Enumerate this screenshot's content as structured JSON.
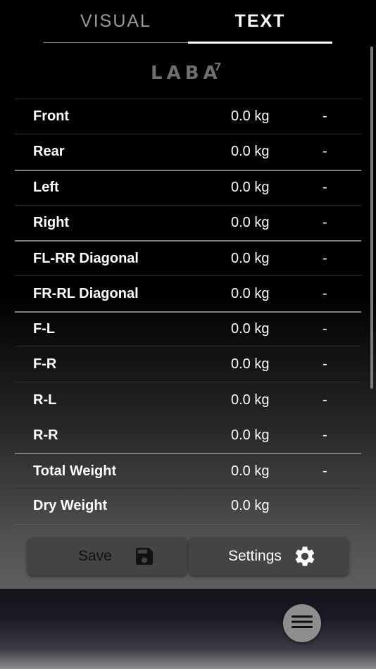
{
  "tabs": [
    {
      "label": "VISUAL",
      "active": false
    },
    {
      "label": "TEXT",
      "active": true
    }
  ],
  "logo": {
    "text": "LABA",
    "superscript": "7"
  },
  "rows": [
    {
      "label": "Front",
      "value": "0.0 kg",
      "extra": "-"
    },
    {
      "label": "Rear",
      "value": "0.0 kg",
      "extra": "-"
    },
    {
      "label": "Left",
      "value": "0.0 kg",
      "extra": "-"
    },
    {
      "label": "Right",
      "value": "0.0 kg",
      "extra": "-"
    },
    {
      "label": "FL-RR Diagonal",
      "value": "0.0 kg",
      "extra": "-"
    },
    {
      "label": "FR-RL Diagonal",
      "value": "0.0 kg",
      "extra": "-"
    },
    {
      "label": "F-L",
      "value": "0.0 kg",
      "extra": "-"
    },
    {
      "label": "F-R",
      "value": "0.0 kg",
      "extra": "-"
    },
    {
      "label": "R-L",
      "value": "0.0 kg",
      "extra": "-"
    },
    {
      "label": "R-R",
      "value": "0.0 kg",
      "extra": "-"
    },
    {
      "label": "Total Weight",
      "value": "0.0 kg",
      "extra": "-"
    },
    {
      "label": "Dry Weight",
      "value": "0.0 kg",
      "extra": ""
    }
  ],
  "buttons": {
    "save": {
      "label": "Save",
      "icon": "floppy-disk-icon"
    },
    "settings": {
      "label": "Settings",
      "icon": "gear-icon"
    }
  },
  "fab": {
    "icon": "hamburger-menu-icon"
  },
  "colors": {
    "button_bg": "#444444",
    "fab_bg": "#8e8e8e",
    "logo": "#6e6e6e"
  }
}
